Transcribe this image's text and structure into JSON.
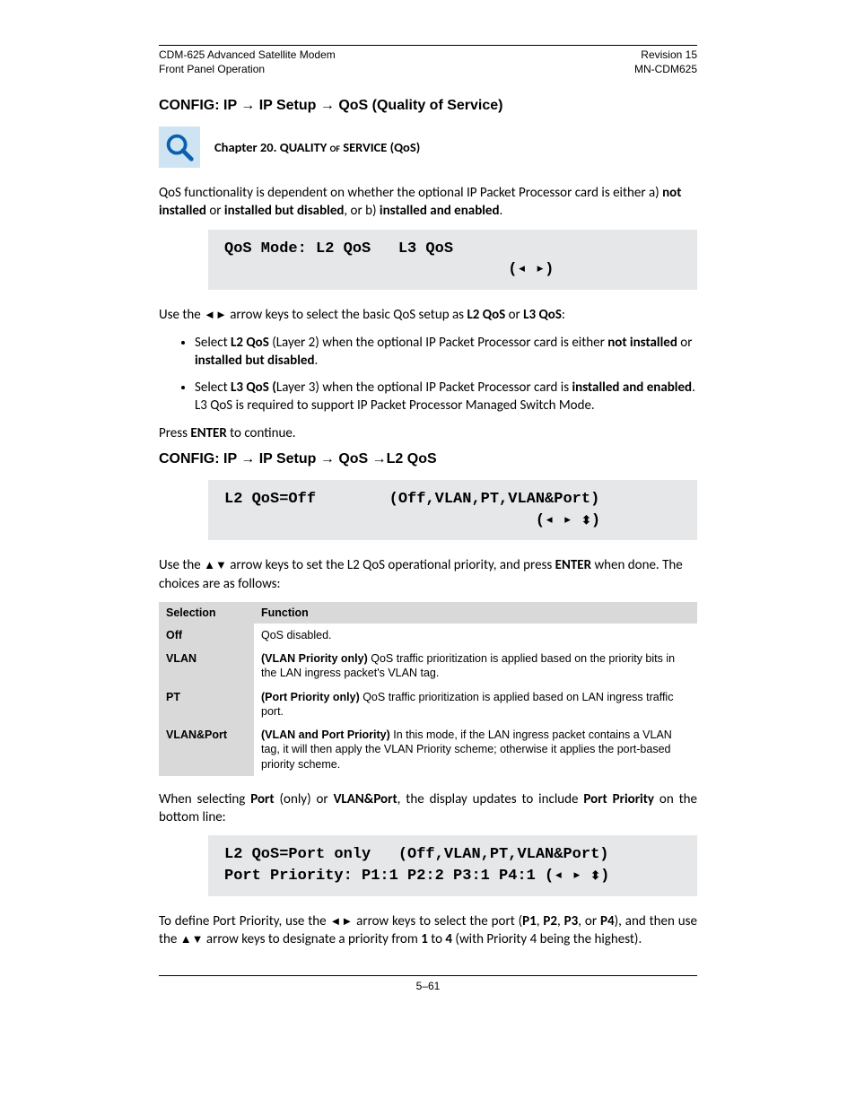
{
  "header": {
    "left1": "CDM-625 Advanced Satellite Modem",
    "left2": "Front Panel Operation",
    "right1": "Revision 15",
    "right2": "MN-CDM625"
  },
  "sec1": {
    "title_pre": "CONFIG: IP ",
    "title_mid1": " IP Setup ",
    "title_mid2": " QoS (Quality of Service)",
    "note": "Chapter 20. QUALITY ",
    "note_sc": "of",
    "note_post": " SERVICE (QoS)",
    "p1_a": "QoS functionality is dependent on whether the optional IP Packet Processor card is either a) ",
    "p1_b": "not installed",
    "p1_c": " or ",
    "p1_d": "installed but disabled",
    "p1_e": ", or b) ",
    "p1_f": "installed and enabled",
    "p1_g": ".",
    "lcd1_l1": "QoS Mode: L2 QoS   L3 QoS",
    "lcd1_l2": "                               (",
    "lcd1_l2b": ")",
    "p2_a": "Use the ",
    "p2_b": " arrow keys to select the basic QoS setup as ",
    "p2_c": "L2 QoS",
    "p2_d": " or ",
    "p2_e": "L3 QoS",
    "p2_f": ":",
    "li1_a": "Select ",
    "li1_b": "L2 QoS",
    "li1_c": " (Layer 2) when the optional IP Packet Processor card is either ",
    "li1_d": "not installed",
    "li1_e": " or ",
    "li1_f": "installed but disabled",
    "li1_g": ".",
    "li2_a": "Select ",
    "li2_b": "L3 QoS (",
    "li2_c": "Layer 3) when the optional IP Packet Processor card is ",
    "li2_d": "installed and enabled",
    "li2_e": ". L3 QoS is required to support IP Packet Processor Managed Switch Mode.",
    "p3_a": "Press ",
    "p3_b": "ENTER",
    "p3_c": " to continue."
  },
  "sec2": {
    "title_pre": "CONFIG: IP ",
    "title_m1": " IP Setup ",
    "title_m2": " QoS ",
    "title_m3": "L2 QoS",
    "lcd2_l1": "L2 QoS=Off        (Off,VLAN,PT,VLAN&Port)",
    "lcd2_l2a": "                                  (",
    "lcd2_l2b": ")",
    "p1_a": "Use the ",
    "p1_b": " arrow keys to set the L2 QoS operational priority, and press ",
    "p1_c": "ENTER",
    "p1_d": " when done. The choices are as follows:",
    "th1": "Selection",
    "th2": "Function",
    "r1s": "Off",
    "r1f": "QoS disabled.",
    "r2s": "VLAN",
    "r2f_b": "(VLAN Priority only)",
    "r2f_t": " QoS traffic prioritization is applied based on the priority bits in the LAN ingress packet's VLAN tag.",
    "r3s": "PT",
    "r3f_b": "(Port Priority only)",
    "r3f_t": " QoS traffic prioritization is applied based on LAN ingress traffic port.",
    "r4s": "VLAN&Port",
    "r4f_b": "(VLAN and Port Priority)",
    "r4f_t": " In this mode, if the LAN ingress packet contains a VLAN tag, it will then apply the VLAN Priority scheme; otherwise it applies the port-based priority scheme.",
    "p2_a": "When selecting ",
    "p2_b": "Port",
    "p2_c": " (only) or ",
    "p2_d": "VLAN&Port",
    "p2_e": ", the display updates to include ",
    "p2_f": "Port Priority",
    "p2_g": " on the bottom line:",
    "lcd3_l1": "L2 QoS=Port only   (Off,VLAN,PT,VLAN&Port)",
    "lcd3_l2a": "Port Priority: P1:1 P2:2 P3:1 P4:1 (",
    "lcd3_l2b": ")",
    "p3_a": "To define Port Priority, use the ",
    "p3_b": " arrow keys to select the port (",
    "p3_c": "P1",
    "p3_d": ", ",
    "p3_e": "P2",
    "p3_f": ", ",
    "p3_g": "P3",
    "p3_h": ", or ",
    "p3_i": "P4",
    "p3_j": "), and then use the ",
    "p3_k": " arrow keys to designate a priority from ",
    "p3_l": "1",
    "p3_m": " to ",
    "p3_n": "4",
    "p3_o": " (with Priority 4 being the highest)."
  },
  "footer": {
    "pagenum": "5–61"
  },
  "glyph": {
    "rarrow": "→",
    "ltri": "◄",
    "rtri": "►",
    "utri": "▲",
    "dtri": "▼",
    "ltri_s": "◂",
    "rtri_s": "▸",
    "udarr": "⇵"
  }
}
